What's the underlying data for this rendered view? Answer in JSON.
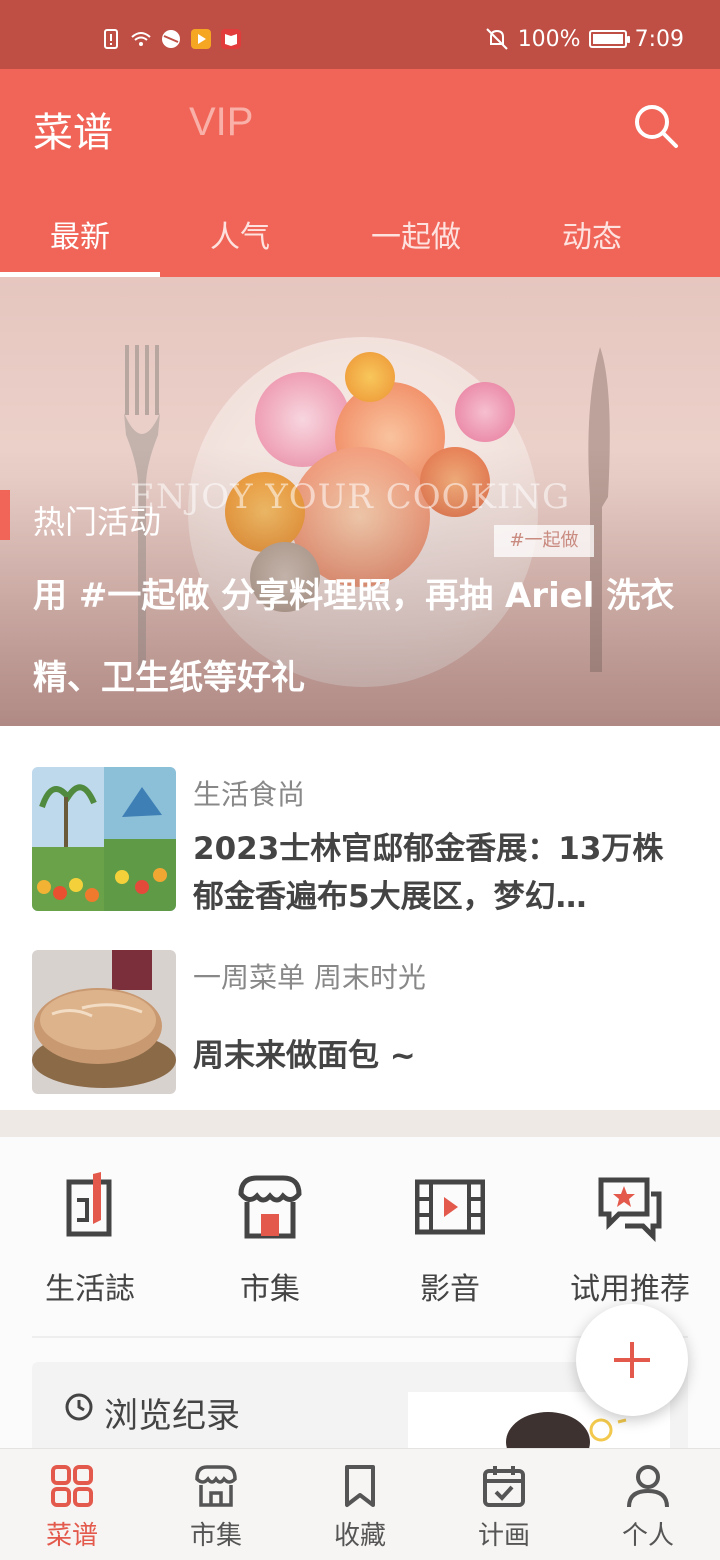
{
  "status_bar": {
    "battery": "100%",
    "battery_level": 1.0,
    "time": "7:09"
  },
  "header": {
    "title": "菜谱",
    "vip": "VIP",
    "tabs": [
      {
        "label": "最新",
        "active": true
      },
      {
        "label": "人气",
        "active": false
      },
      {
        "label": "一起做",
        "active": false
      },
      {
        "label": "动态",
        "active": false
      }
    ]
  },
  "banner": {
    "image_text": "ENJOY YOUR COOKING",
    "image_tag": "#一起做",
    "section_label": "热门活动",
    "headline": "用 #一起做 分享料理照，再抽 Ariel 洗衣精、卫生纸等好礼"
  },
  "articles": [
    {
      "category": "生活食尚",
      "title": "2023士林官邸郁金香展：13万株郁金香遍布5大展区，梦幻…"
    },
    {
      "category": "一周菜单 周末时光",
      "title": "周末来做面包 ~"
    }
  ],
  "quick_links": [
    {
      "label": "生活誌",
      "icon": "magazine-icon"
    },
    {
      "label": "市集",
      "icon": "market-icon"
    },
    {
      "label": "影音",
      "icon": "video-icon"
    },
    {
      "label": "试用推荐",
      "icon": "trial-icon"
    }
  ],
  "history": {
    "label": "浏览纪录"
  },
  "bottom_nav": [
    {
      "label": "菜谱",
      "icon": "grid-icon",
      "active": true
    },
    {
      "label": "市集",
      "icon": "shop-icon",
      "active": false
    },
    {
      "label": "收藏",
      "icon": "bookmark-icon",
      "active": false
    },
    {
      "label": "计画",
      "icon": "calendar-icon",
      "active": false
    },
    {
      "label": "个人",
      "icon": "person-icon",
      "active": false
    }
  ],
  "colors": {
    "status_bar": "#bf4f45",
    "header": "#f06558",
    "accent": "#e35a4d"
  }
}
